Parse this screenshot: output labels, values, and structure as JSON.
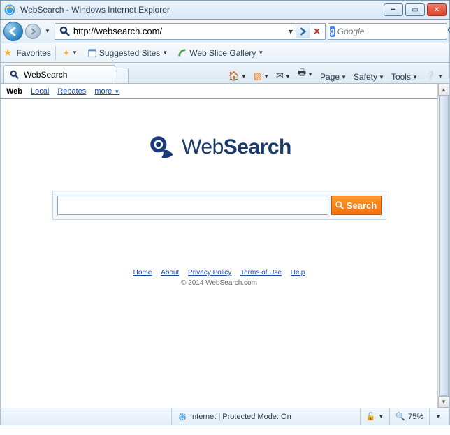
{
  "window": {
    "title": "WebSearch - Windows Internet Explorer"
  },
  "nav": {
    "url": "http://websearch.com/",
    "search_provider": "Google",
    "search_placeholder": "Google"
  },
  "favorites": {
    "label": "Favorites",
    "suggested": "Suggested Sites",
    "webslice": "Web Slice Gallery"
  },
  "tab": {
    "title": "WebSearch"
  },
  "commandbar": {
    "page": "Page",
    "safety": "Safety",
    "tools": "Tools"
  },
  "page": {
    "nav": {
      "web": "Web",
      "local": "Local",
      "rebates": "Rebates",
      "more": "more"
    },
    "logo_light": "Web",
    "logo_bold": "Search",
    "search_button": "Search",
    "search_value": "",
    "footer_links": {
      "home": "Home",
      "about": "About",
      "privacy": "Privacy Policy",
      "terms": "Terms of Use",
      "help": "Help"
    },
    "copyright": "© 2014 WebSearch.com"
  },
  "status": {
    "zone": "Internet | Protected Mode: On",
    "zoom": "75%"
  }
}
